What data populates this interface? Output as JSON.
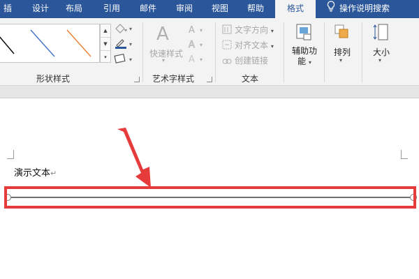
{
  "tabs": [
    {
      "label": "插入"
    },
    {
      "label": "设计"
    },
    {
      "label": "布局"
    },
    {
      "label": "引用"
    },
    {
      "label": "邮件"
    },
    {
      "label": "审阅"
    },
    {
      "label": "视图"
    },
    {
      "label": "帮助"
    },
    {
      "label": "格式"
    }
  ],
  "tell_me": {
    "label": "操作说明搜索",
    "icon": "lightbulb-icon"
  },
  "ribbon": {
    "shape_styles": {
      "label": "形状样式",
      "swatch_colors": [
        "#000000",
        "#4472c4",
        "#ed7d31"
      ]
    },
    "art_text": {
      "label": "艺术字样式",
      "quick_styles": "快速样式"
    },
    "text": {
      "label": "文本",
      "direction": "文字方向",
      "align": "对齐文本",
      "link": "创建链接"
    },
    "accessibility": {
      "label_line1": "辅助功",
      "label_line2": "能"
    },
    "arrange": {
      "label": "排列"
    },
    "size": {
      "label": "大小"
    }
  },
  "document": {
    "body_text": "演示文本",
    "return_mark": "↵"
  },
  "colors": {
    "tab_bar": "#2b579a",
    "highlight": "#e63b3b",
    "arrow": "#e63b3b"
  }
}
